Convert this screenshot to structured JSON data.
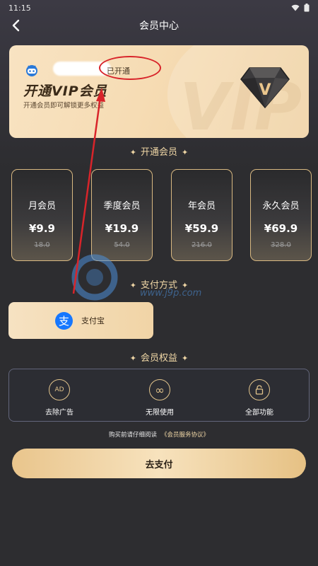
{
  "status_bar": {
    "time": "11:15",
    "icons": [
      "wifi-icon",
      "battery-icon"
    ]
  },
  "nav": {
    "title": "会员中心",
    "back_icon": "chevron-left-icon"
  },
  "vip_card": {
    "member_status": "已开通",
    "title": "开通VIP会员",
    "subtitle": "开通会员即可解锁更多权益",
    "watermark": "VIP",
    "badge_letter": "V"
  },
  "sections": {
    "open_member": "开通会员",
    "payment_method": "支付方式",
    "member_benefits": "会员权益"
  },
  "plans": [
    {
      "name": "月会员",
      "price": "¥9.9",
      "original": "18.0"
    },
    {
      "name": "季度会员",
      "price": "¥19.9",
      "original": "54.0"
    },
    {
      "name": "年会员",
      "price": "¥59.9",
      "original": "216.0"
    },
    {
      "name": "永久会员",
      "price": "¥69.9",
      "original": "328.0"
    }
  ],
  "payment": {
    "icon_glyph": "支",
    "label": "支付宝"
  },
  "benefits": [
    {
      "icon": "ad-icon",
      "glyph": "AD",
      "label": "去除广告"
    },
    {
      "icon": "infinity-icon",
      "glyph": "∞",
      "label": "无限使用"
    },
    {
      "icon": "unlock-icon",
      "glyph": "",
      "label": "全部功能"
    }
  ],
  "agreement": {
    "text": "购买前请仔细阅读",
    "link": "《会员服务协议》"
  },
  "pay_button": "去支付",
  "watermark": {
    "url": "www.j9p.com"
  },
  "colors": {
    "accent_gold": "#f0d7a6",
    "annotation_red": "#d8242a",
    "alipay_blue": "#1677ff"
  }
}
